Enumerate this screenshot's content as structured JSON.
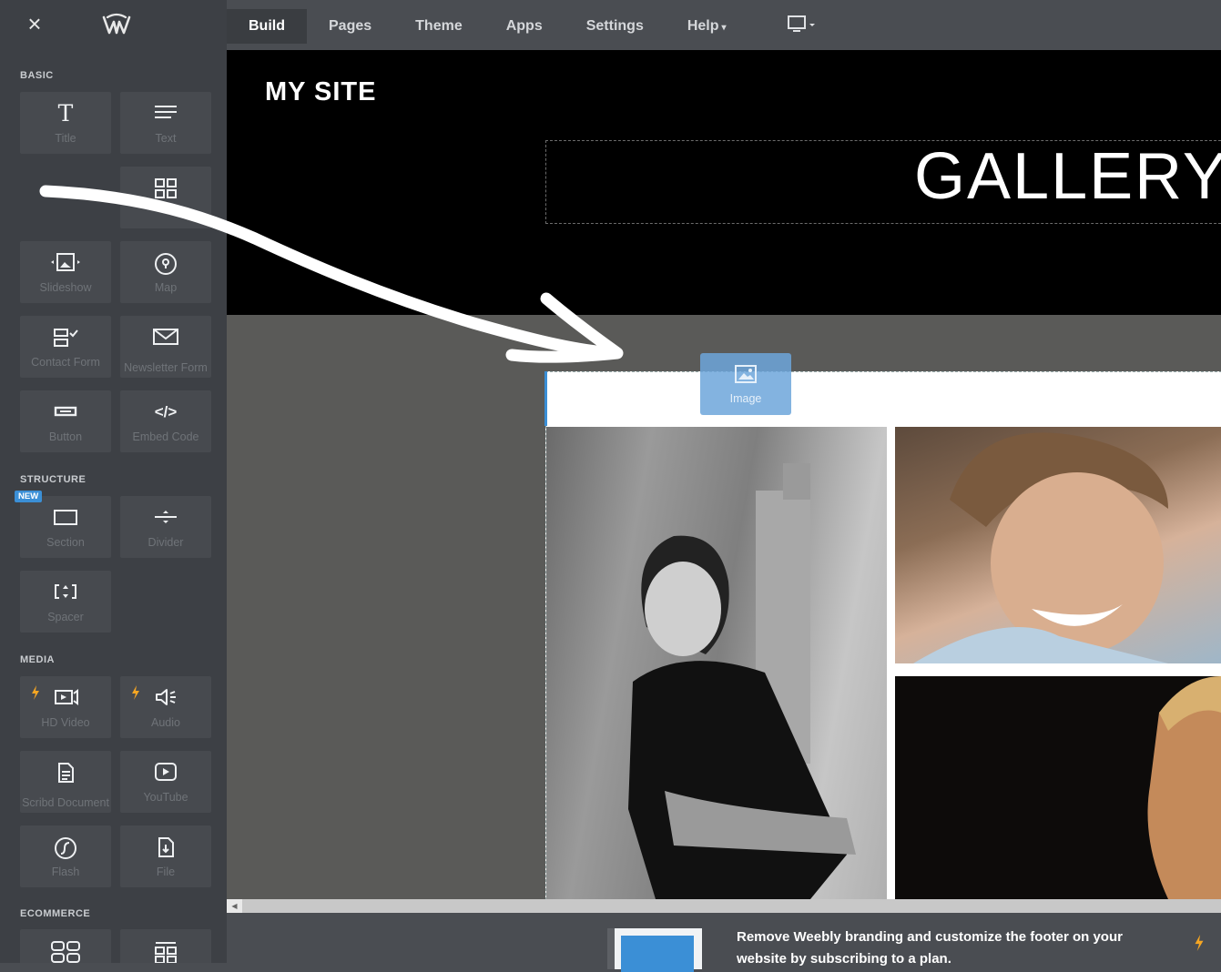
{
  "topbar": {
    "close_label": "×",
    "nav": [
      {
        "label": "Build"
      },
      {
        "label": "Pages"
      },
      {
        "label": "Theme"
      },
      {
        "label": "Apps"
      },
      {
        "label": "Settings"
      },
      {
        "label": "Help",
        "caret": "▾"
      }
    ]
  },
  "sidebar": {
    "sections": {
      "basic": "BASIC",
      "structure": "STRUCTURE",
      "media": "MEDIA",
      "ecommerce": "ECOMMERCE"
    },
    "new_badge": "NEW",
    "tiles": {
      "title": {
        "label": "Title",
        "glyph": "T"
      },
      "text": {
        "label": "Text"
      },
      "slideshow": {
        "label": "Slideshow"
      },
      "map": {
        "label": "Map"
      },
      "contact_form": {
        "label": "Contact Form"
      },
      "newsletter_form": {
        "label": "Newsletter Form"
      },
      "button": {
        "label": "Button"
      },
      "embed_code": {
        "label": "Embed Code",
        "glyph": "</>"
      },
      "section": {
        "label": "Section"
      },
      "divider": {
        "label": "Divider"
      },
      "spacer": {
        "label": "Spacer"
      },
      "hd_video": {
        "label": "HD Video"
      },
      "audio": {
        "label": "Audio"
      },
      "scribd_document": {
        "label": "Scribd Document"
      },
      "youtube": {
        "label": "YouTube"
      },
      "flash": {
        "label": "Flash"
      },
      "file": {
        "label": "File"
      }
    }
  },
  "canvas": {
    "site_title": "MY SITE",
    "gallery_heading": "GALLERY",
    "drag_element_label": "Image"
  },
  "footer": {
    "promo_text": "Remove Weebly branding and customize the footer on your website by subscribing to a plan."
  },
  "colors": {
    "accent_blue": "#3b8fd6",
    "bolt_orange": "#f5a623"
  }
}
